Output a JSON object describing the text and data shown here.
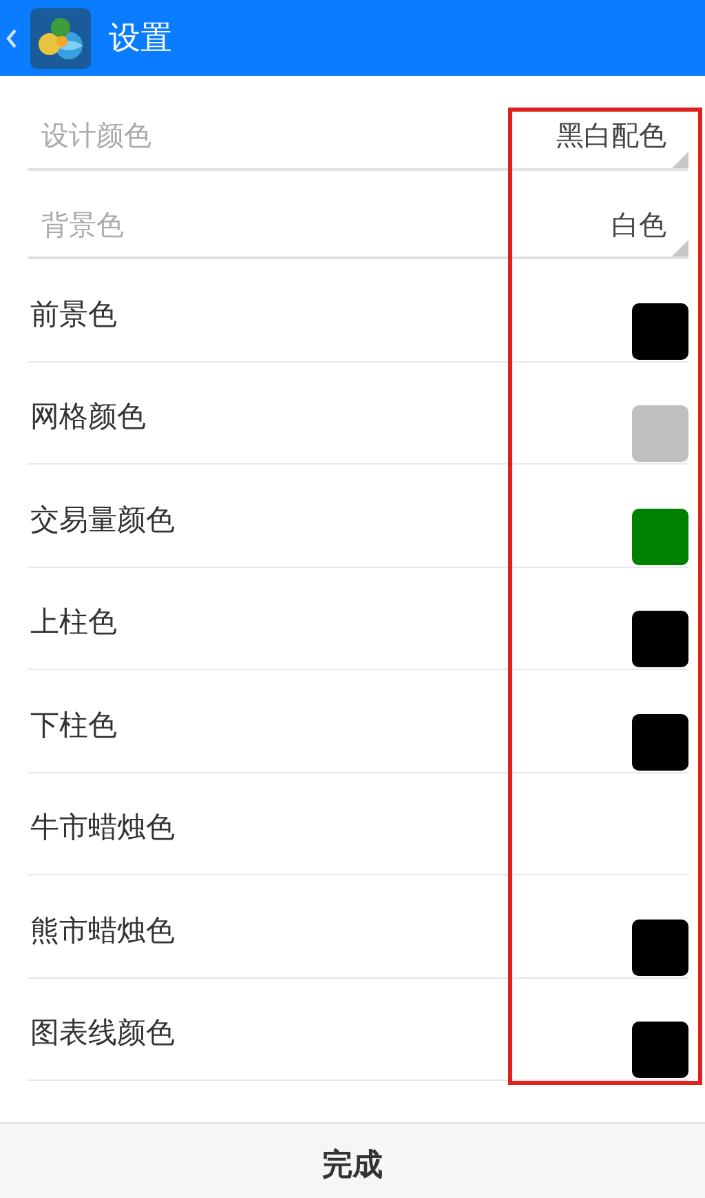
{
  "header": {
    "title": "设置"
  },
  "dropdowns": [
    {
      "label": "设计颜色",
      "value": "黑白配色"
    },
    {
      "label": "背景色",
      "value": "白色"
    }
  ],
  "colors": [
    {
      "label": "前景色",
      "color": "#000000"
    },
    {
      "label": "网格颜色",
      "color": "#c0c0c0"
    },
    {
      "label": "交易量颜色",
      "color": "#008000"
    },
    {
      "label": "上柱色",
      "color": "#000000"
    },
    {
      "label": "下柱色",
      "color": "#000000"
    },
    {
      "label": "牛市蜡烛色"
    },
    {
      "label": "熊市蜡烛色",
      "color": "#000000"
    },
    {
      "label": "图表线颜色",
      "color": "#000000"
    }
  ],
  "footer": {
    "button": "完成"
  }
}
